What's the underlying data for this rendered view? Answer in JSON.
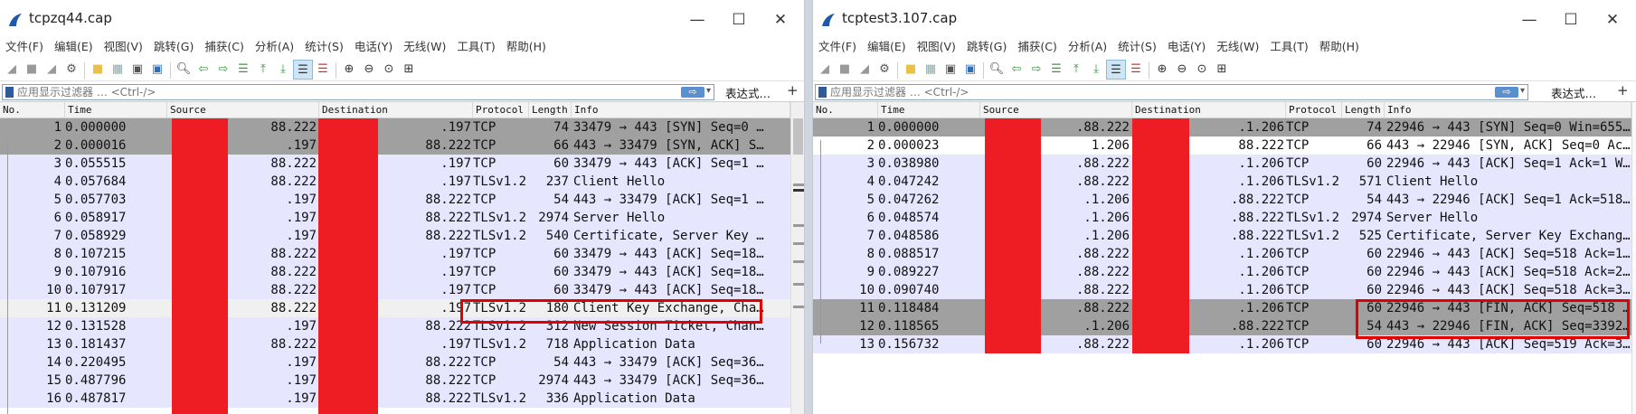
{
  "colors": {
    "tcp_row": "#e7e6ff",
    "syn_row": "#a0a0a0",
    "redaction": "#ee1d24",
    "highlight": "#e00000"
  },
  "window_controls": {
    "minimize": "—",
    "maximize": "☐",
    "close": "✕"
  },
  "menu": [
    "文件(F)",
    "编辑(E)",
    "视图(V)",
    "跳转(G)",
    "捕获(C)",
    "分析(A)",
    "统计(S)",
    "电话(Y)",
    "无线(W)",
    "工具(T)",
    "帮助(H)"
  ],
  "filter": {
    "placeholder": "应用显示过滤器 … <Ctrl-/>",
    "arrow": "⇨",
    "dropdown": "▾",
    "expression": "表达式…",
    "plus": "+"
  },
  "columns": {
    "no": "No.",
    "time": "Time",
    "source": "Source",
    "destination": "Destination",
    "protocol": "Protocol",
    "length": "Length",
    "info": "Info"
  },
  "left": {
    "title": "tcpzq44.cap",
    "rows": [
      {
        "no": "1",
        "time": "0.000000",
        "src": "88.222",
        "dst": ".197",
        "proto": "TCP",
        "len": "74",
        "info": "33479 → 443 [SYN] Seq=0 …"
      },
      {
        "no": "2",
        "time": "0.000016",
        "src": ".197",
        "dst": "88.222",
        "proto": "TCP",
        "len": "66",
        "info": "443 → 33479 [SYN, ACK] S…"
      },
      {
        "no": "3",
        "time": "0.055515",
        "src": "88.222",
        "dst": ".197",
        "proto": "TCP",
        "len": "60",
        "info": "33479 → 443 [ACK] Seq=1 …"
      },
      {
        "no": "4",
        "time": "0.057684",
        "src": "88.222",
        "dst": ".197",
        "proto": "TLSv1.2",
        "len": "237",
        "info": "Client Hello"
      },
      {
        "no": "5",
        "time": "0.057703",
        "src": ".197",
        "dst": "88.222",
        "proto": "TCP",
        "len": "54",
        "info": "443 → 33479 [ACK] Seq=1 …"
      },
      {
        "no": "6",
        "time": "0.058917",
        "src": ".197",
        "dst": "88.222",
        "proto": "TLSv1.2",
        "len": "2974",
        "info": "Server Hello"
      },
      {
        "no": "7",
        "time": "0.058929",
        "src": ".197",
        "dst": "88.222",
        "proto": "TLSv1.2",
        "len": "540",
        "info": "Certificate, Server Key …"
      },
      {
        "no": "8",
        "time": "0.107215",
        "src": "88.222",
        "dst": ".197",
        "proto": "TCP",
        "len": "60",
        "info": "33479 → 443 [ACK] Seq=18…"
      },
      {
        "no": "9",
        "time": "0.107916",
        "src": "88.222",
        "dst": ".197",
        "proto": "TCP",
        "len": "60",
        "info": "33479 → 443 [ACK] Seq=18…"
      },
      {
        "no": "10",
        "time": "0.107917",
        "src": "88.222",
        "dst": ".197",
        "proto": "TCP",
        "len": "60",
        "info": "33479 → 443 [ACK] Seq=18…"
      },
      {
        "no": "11",
        "time": "0.131209",
        "src": "88.222",
        "dst": ".197",
        "proto": "TLSv1.2",
        "len": "180",
        "info": "Client Key Exchange, Cha…"
      },
      {
        "no": "12",
        "time": "0.131528",
        "src": ".197",
        "dst": "88.222",
        "proto": "TLSv1.2",
        "len": "312",
        "info": "New Session Ticket, Chan…"
      },
      {
        "no": "13",
        "time": "0.181437",
        "src": "88.222",
        "dst": ".197",
        "proto": "TLSv1.2",
        "len": "718",
        "info": "Application Data"
      },
      {
        "no": "14",
        "time": "0.220495",
        "src": ".197",
        "dst": "88.222",
        "proto": "TCP",
        "len": "54",
        "info": "443 → 33479 [ACK] Seq=36…"
      },
      {
        "no": "15",
        "time": "0.487796",
        "src": ".197",
        "dst": "88.222",
        "proto": "TCP",
        "len": "2974",
        "info": "443 → 33479 [ACK] Seq=36…"
      },
      {
        "no": "16",
        "time": "0.487817",
        "src": ".197",
        "dst": "88.222",
        "proto": "TLSv1.2",
        "len": "336",
        "info": "Application Data"
      }
    ]
  },
  "right": {
    "title": "tcptest3.107.cap",
    "rows": [
      {
        "no": "1",
        "time": "0.000000",
        "src": ".88.222",
        "dst": ".1.206",
        "proto": "TCP",
        "len": "74",
        "info": "22946 → 443 [SYN] Seq=0 Win=655…"
      },
      {
        "no": "2",
        "time": "0.000023",
        "src": "1.206",
        "dst": "88.222",
        "proto": "TCP",
        "len": "66",
        "info": "443 → 22946 [SYN, ACK] Seq=0 Ac…"
      },
      {
        "no": "3",
        "time": "0.038980",
        "src": ".88.222",
        "dst": ".1.206",
        "proto": "TCP",
        "len": "60",
        "info": "22946 → 443 [ACK] Seq=1 Ack=1 W…"
      },
      {
        "no": "4",
        "time": "0.047242",
        "src": ".88.222",
        "dst": ".1.206",
        "proto": "TLSv1.2",
        "len": "571",
        "info": "Client Hello"
      },
      {
        "no": "5",
        "time": "0.047262",
        "src": ".1.206",
        "dst": ".88.222",
        "proto": "TCP",
        "len": "54",
        "info": "443 → 22946 [ACK] Seq=1 Ack=518…"
      },
      {
        "no": "6",
        "time": "0.048574",
        "src": ".1.206",
        "dst": ".88.222",
        "proto": "TLSv1.2",
        "len": "2974",
        "info": "Server Hello"
      },
      {
        "no": "7",
        "time": "0.048586",
        "src": ".1.206",
        "dst": ".88.222",
        "proto": "TLSv1.2",
        "len": "525",
        "info": "Certificate, Server Key Exchang…"
      },
      {
        "no": "8",
        "time": "0.088517",
        "src": ".88.222",
        "dst": ".1.206",
        "proto": "TCP",
        "len": "60",
        "info": "22946 → 443 [ACK] Seq=518 Ack=1…"
      },
      {
        "no": "9",
        "time": "0.089227",
        "src": ".88.222",
        "dst": ".1.206",
        "proto": "TCP",
        "len": "60",
        "info": "22946 → 443 [ACK] Seq=518 Ack=2…"
      },
      {
        "no": "10",
        "time": "0.090740",
        "src": ".88.222",
        "dst": ".1.206",
        "proto": "TCP",
        "len": "60",
        "info": "22946 → 443 [ACK] Seq=518 Ack=3…"
      },
      {
        "no": "11",
        "time": "0.118484",
        "src": ".88.222",
        "dst": ".1.206",
        "proto": "TCP",
        "len": "60",
        "info": "22946 → 443 [FIN, ACK] Seq=518 …"
      },
      {
        "no": "12",
        "time": "0.118565",
        "src": ".1.206",
        "dst": ".88.222",
        "proto": "TCP",
        "len": "54",
        "info": "443 → 22946 [FIN, ACK] Seq=3392…"
      },
      {
        "no": "13",
        "time": "0.156732",
        "src": ".88.222",
        "dst": ".1.206",
        "proto": "TCP",
        "len": "60",
        "info": "22946 → 443 [ACK] Seq=519 Ack=3…"
      }
    ]
  }
}
